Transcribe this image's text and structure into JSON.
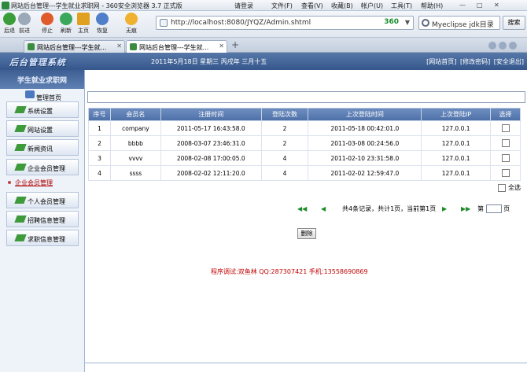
{
  "browser": {
    "window_title": "网站后台管理---学生就业求职网 - 360安全浏览器 3.7 正式版",
    "menu": [
      "请登录",
      "文件(F)",
      "查看(V)",
      "收藏(B)",
      "帐户(U)",
      "工具(T)",
      "帮助(H)"
    ],
    "nav": [
      {
        "label": "后退",
        "color": "#3a9d3a"
      },
      {
        "label": "前进",
        "color": "#9aa8b8"
      },
      {
        "label": "停止",
        "color": "#e05a2b"
      },
      {
        "label": "刷新",
        "color": "#3aa85a"
      },
      {
        "label": "主页",
        "color": "#e0a020"
      },
      {
        "label": "恢复",
        "color": "#4f7fc8"
      },
      {
        "label": "无痕",
        "color": "#f0b030"
      }
    ],
    "address_url": "http://localhost:8080/JYQZ/Admin.shtml",
    "address_brand": "360",
    "search_value": "Myeclipse jdk目录",
    "search_button": "搜索",
    "tabs": [
      {
        "label": "网站后台管理---学生就...",
        "active": false
      },
      {
        "label": "网站后台管理---学生就...",
        "active": true
      }
    ]
  },
  "header": {
    "logo": "后台管理系统",
    "date": "2011年5月18日 星期三 丙戌年 三月十五",
    "links": [
      "[网站首页]",
      "[修改密码]",
      "[安全退出]"
    ]
  },
  "sidebar": {
    "title": "学生就业求职网",
    "home": "管理首页",
    "items": [
      "系统设置",
      "网站设置",
      "新闻资讯",
      "企业会员管理",
      "个人会员管理",
      "招聘信息管理",
      "求职信息管理"
    ],
    "sub_item": "企业会员管理"
  },
  "table": {
    "headers": [
      "序号",
      "会员名",
      "注册时间",
      "登陆次数",
      "上次登陆时间",
      "上次登陆IP",
      "选择"
    ],
    "rows": [
      [
        "1",
        "company",
        "2011-05-17 16:43:58.0",
        "2",
        "2011-05-18 00:42:01.0",
        "127.0.0.1"
      ],
      [
        "2",
        "bbbb",
        "2008-03-07 23:46:31.0",
        "2",
        "2011-03-08 00:24:56.0",
        "127.0.0.1"
      ],
      [
        "3",
        "vvvv",
        "2008-02-08 17:00:05.0",
        "4",
        "2011-02-10 23:31:58.0",
        "127.0.0.1"
      ],
      [
        "4",
        "ssss",
        "2008-02-02 12:11:20.0",
        "4",
        "2011-02-02 12:59:47.0",
        "127.0.0.1"
      ]
    ],
    "select_all": "全选"
  },
  "pager": {
    "info": "共4条记录，共计1页，当前第1页",
    "first": "◀◀",
    "prev": "◀",
    "next": "▶",
    "last": "▶▶",
    "jump_prefix": "第",
    "jump_suffix": "页"
  },
  "actions": {
    "delete": "删除"
  },
  "footer": "程序调试:双鱼林 QQ:287307421 手机:13558690869"
}
